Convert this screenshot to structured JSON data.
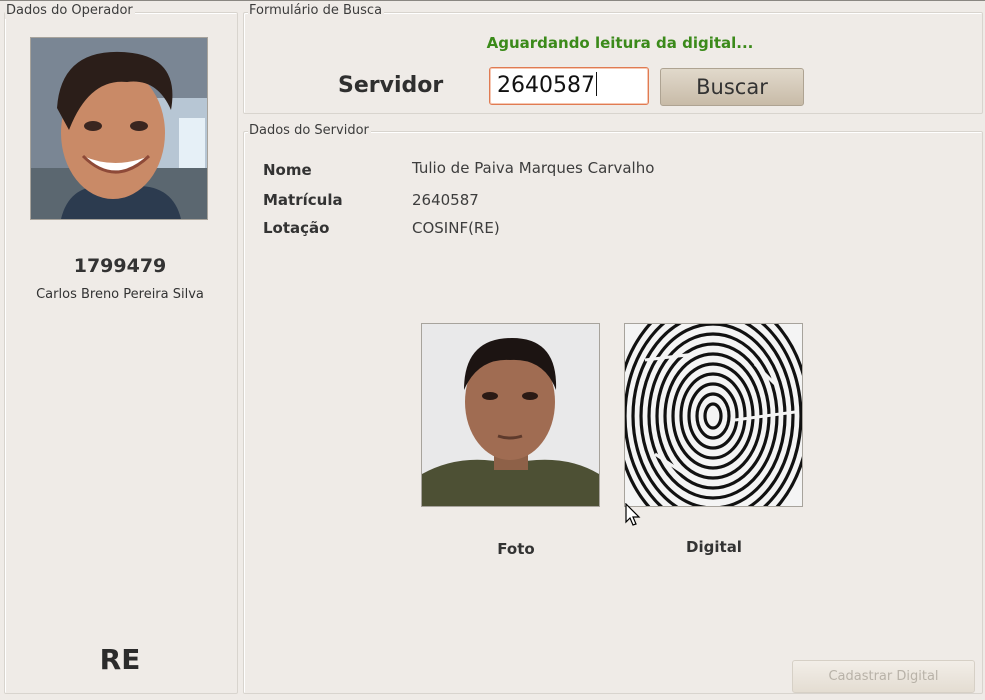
{
  "operator_panel": {
    "legend": "Dados do Operador",
    "id": "1799479",
    "name": "Carlos Breno Pereira Silva",
    "unit": "RE"
  },
  "search_form": {
    "legend": "Formulário de Busca",
    "status": "Aguardando leitura da digital...",
    "field_label": "Servidor",
    "field_value": "2640587",
    "button_label": "Buscar"
  },
  "server_panel": {
    "legend": "Dados do Servidor",
    "fields": [
      {
        "label": "Nome",
        "value": "Tulio de Paiva Marques Carvalho"
      },
      {
        "label": "Matrícula",
        "value": "2640587"
      },
      {
        "label": "Lotação",
        "value": "COSINF(RE)"
      }
    ],
    "photo_caption": "Foto",
    "fingerprint_caption": "Digital",
    "register_button": "Cadastrar Digital"
  },
  "colors": {
    "window_bg": "#efebe7",
    "status_green": "#3b8a1a",
    "input_focus_border": "#e07b52",
    "button_bg": "#c8bba8"
  }
}
